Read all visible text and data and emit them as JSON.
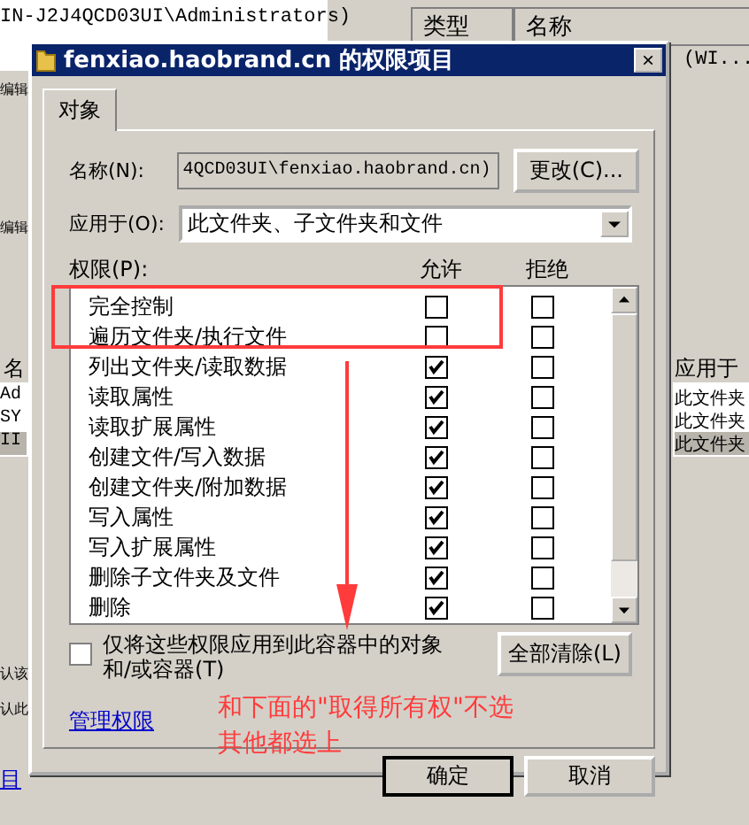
{
  "background": {
    "account": "IN-J2J4QCD03UI\\Administrators)",
    "columns": [
      "类型",
      "名称"
    ],
    "cell": "(WI...",
    "left_labels": [
      "编辑",
      "编辑"
    ],
    "left_header": "名",
    "left_rows": [
      {
        "text": "Ad",
        "selected": false
      },
      {
        "text": "SY",
        "selected": false
      },
      {
        "text": "II",
        "selected": true
      }
    ],
    "right_header": "应用于",
    "right_rows": [
      {
        "text": "此文件夹",
        "selected": false
      },
      {
        "text": "此文件夹",
        "selected": false
      },
      {
        "text": "此文件夹",
        "selected": true
      }
    ],
    "notes": [
      "认该",
      "认此"
    ],
    "link": "目"
  },
  "window": {
    "title": "fenxiao.haobrand.cn 的权限项目",
    "close": "×"
  },
  "tabs": [
    {
      "label": "对象",
      "selected": true
    }
  ],
  "name_field": {
    "label": "名称(N):",
    "value": "4QCD03UI\\fenxiao.haobrand.cn)",
    "button": "更改(C)..."
  },
  "apply_to": {
    "label": "应用于(O):",
    "value": "此文件夹、子文件夹和文件"
  },
  "permissions": {
    "label": "权限(P):",
    "columns": [
      "允许",
      "拒绝"
    ],
    "rows": [
      {
        "name": "完全控制",
        "allow": false,
        "deny": false
      },
      {
        "name": "遍历文件夹/执行文件",
        "allow": false,
        "deny": false
      },
      {
        "name": "列出文件夹/读取数据",
        "allow": true,
        "deny": false
      },
      {
        "name": "读取属性",
        "allow": true,
        "deny": false
      },
      {
        "name": "读取扩展属性",
        "allow": true,
        "deny": false
      },
      {
        "name": "创建文件/写入数据",
        "allow": true,
        "deny": false
      },
      {
        "name": "创建文件夹/附加数据",
        "allow": true,
        "deny": false
      },
      {
        "name": "写入属性",
        "allow": true,
        "deny": false
      },
      {
        "name": "写入扩展属性",
        "allow": true,
        "deny": false
      },
      {
        "name": "删除子文件夹及文件",
        "allow": true,
        "deny": false
      },
      {
        "name": "删除",
        "allow": true,
        "deny": false
      }
    ]
  },
  "apply_only": {
    "label": "仅将这些权限应用到此容器中的对象和/或容器(T)",
    "checked": false
  },
  "clear_button": "全部清除(L)",
  "manage_link": "管理权限",
  "buttons": [
    "确定",
    "取消"
  ],
  "annotation": {
    "text": [
      "和下面的\"取得所有权\"不选",
      "其他都选上"
    ]
  }
}
